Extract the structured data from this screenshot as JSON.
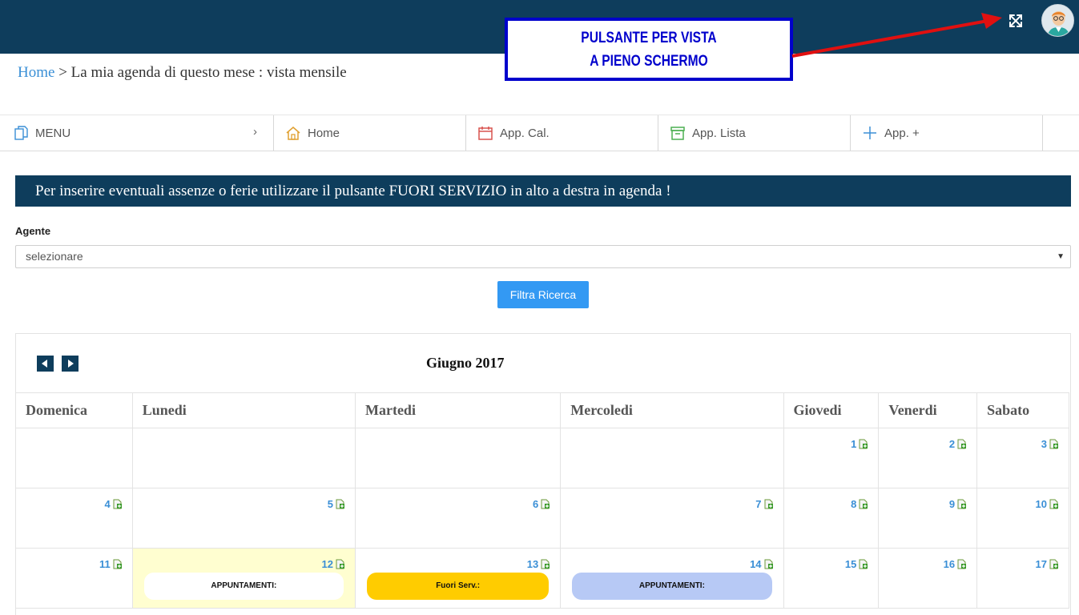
{
  "topbar": {
    "fullscreen_icon": "expand-arrows-icon",
    "avatar_icon": "user-avatar-icon"
  },
  "annotation": {
    "line1": "PULSANTE PER VISTA",
    "line2": "A PIENO SCHERMO"
  },
  "breadcrumb": {
    "home": "Home",
    "separator": ">",
    "current": "La mia agenda di questo mese : vista mensile"
  },
  "nav": {
    "menu": "MENU",
    "menu_chevron": "›",
    "home": "Home",
    "cal": "App. Cal.",
    "list": "App. Lista",
    "add": "App. +"
  },
  "notice": "Per inserire eventuali assenze o ferie utilizzare il pulsante FUORI SERVIZIO in alto a destra in agenda !",
  "filter": {
    "label": "Agente",
    "selected": "selezionare",
    "button": "Filtra Ricerca"
  },
  "calendar": {
    "title": "Giugno 2017",
    "weekdays": [
      "Domenica",
      "Lunedi",
      "Martedi",
      "Mercoledi",
      "Giovedi",
      "Venerdi",
      "Sabato"
    ],
    "weeks": [
      [
        null,
        null,
        null,
        null,
        "1",
        "2",
        "3"
      ],
      [
        "4",
        "5",
        "6",
        "7",
        "8",
        "9",
        "10"
      ],
      [
        "11",
        "12",
        "13",
        "14",
        "15",
        "16",
        "17"
      ]
    ],
    "events": {
      "12": "APPUNTAMENTI:",
      "13": "Fuori Serv.:",
      "14": "APPUNTAMENTI:"
    }
  },
  "colors": {
    "header": "#0e3d5c",
    "link": "#3a8fd6",
    "button": "#3399f3",
    "today": "#fffed0",
    "out_of_service": "#ffcc00",
    "appointments_blue": "#b7c9f5"
  }
}
